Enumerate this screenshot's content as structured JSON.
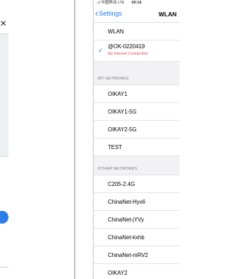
{
  "status_bar": {
    "carrier": "..ıl 中国移动  LTE",
    "time": "09:16"
  },
  "nav": {
    "back_label": "Settings",
    "title": "WLAN"
  },
  "wlan_row": {
    "label": "WLAN"
  },
  "connected": {
    "name": "@OK-0220419",
    "status": "No Internet Connection"
  },
  "my_networks": {
    "header": "MY NETWORKS",
    "items": [
      "OIKAY1",
      "OIKAY1-5G",
      "OIKAY2-5G",
      "TEST"
    ]
  },
  "other_networks": {
    "header": "OTHER NETWORKS",
    "items": [
      "C205-2.4G",
      "ChinaNet-Hyx6",
      "ChinaNet-jYVy",
      "ChinaNet-kxhb",
      "ChinaNet-mRV2",
      "OIKAY2"
    ]
  },
  "left_panel": {
    "close_symbol": "×"
  },
  "colors": {
    "accent": "#1a7cf5",
    "warning": "#e0484a",
    "fab": "#2b7de9"
  }
}
